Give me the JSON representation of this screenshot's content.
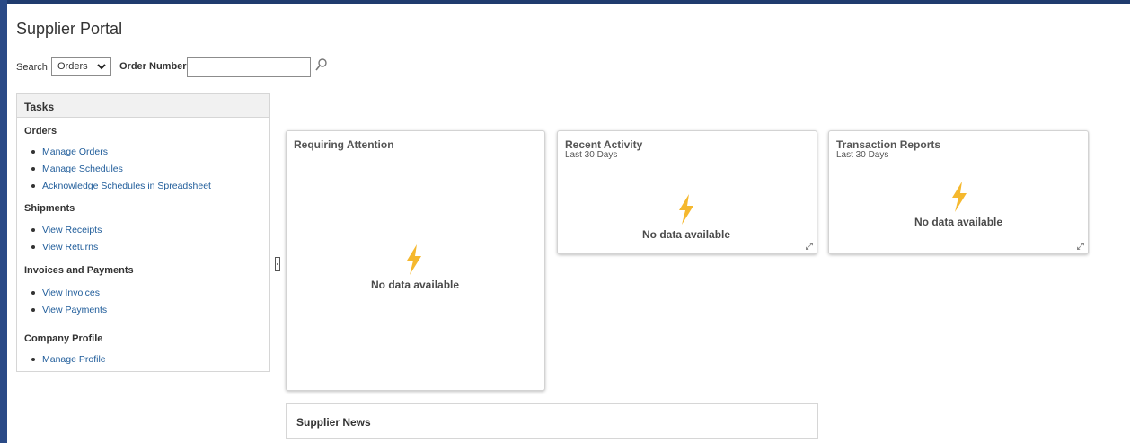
{
  "header": {
    "title": "Supplier Portal"
  },
  "search": {
    "label": "Search",
    "category": "Orders",
    "order_label": "Order Number",
    "order_value": ""
  },
  "tasks": {
    "title": "Tasks",
    "groups": [
      {
        "label": "Orders",
        "items": [
          "Manage Orders",
          "Manage Schedules",
          "Acknowledge Schedules in Spreadsheet"
        ]
      },
      {
        "label": "Shipments",
        "items": [
          "View Receipts",
          "View Returns"
        ]
      },
      {
        "label": "Invoices and Payments",
        "items": [
          "View Invoices",
          "View Payments"
        ]
      },
      {
        "label": "Company Profile",
        "items": [
          "Manage Profile"
        ]
      }
    ]
  },
  "cards": {
    "requiring_attention": {
      "title": "Requiring Attention",
      "empty": "No data available"
    },
    "recent_activity": {
      "title": "Recent Activity",
      "subtitle": "Last 30 Days",
      "empty": "No data available"
    },
    "transaction_reports": {
      "title": "Transaction Reports",
      "subtitle": "Last 30 Days",
      "empty": "No data available"
    }
  },
  "news": {
    "title": "Supplier News"
  },
  "icons": {
    "empty_state": "lightning-bolt-icon",
    "search": "magnifier-icon",
    "expand": "expand-arrows-icon",
    "collapse": "collapse-panel-icon"
  },
  "colors": {
    "link": "#1f5c9a",
    "bolt": "#f5b82e",
    "header_bar": "#1f3b6e"
  }
}
